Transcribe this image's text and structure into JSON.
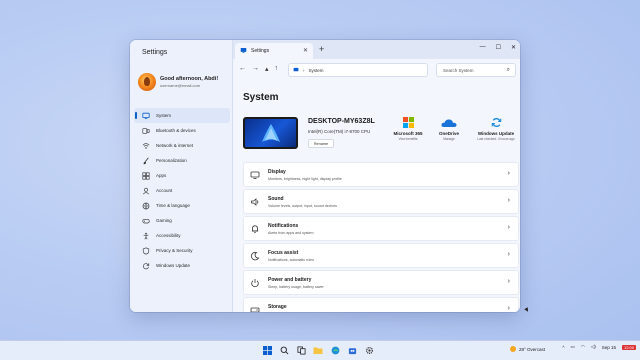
{
  "app": {
    "title": "Settings",
    "tab_label": "Settings"
  },
  "profile": {
    "greeting": "Good afternoon, Abdi!",
    "email": "username@email.com"
  },
  "sidebar": {
    "items": [
      {
        "label": "System",
        "icon": "monitor-icon",
        "active": true
      },
      {
        "label": "Bluetooth & devices",
        "icon": "bluetooth-icon"
      },
      {
        "label": "Network & internet",
        "icon": "wifi-icon"
      },
      {
        "label": "Personalization",
        "icon": "brush-icon"
      },
      {
        "label": "Apps",
        "icon": "apps-icon"
      },
      {
        "label": "Account",
        "icon": "person-icon"
      },
      {
        "label": "Time & language",
        "icon": "globe-icon"
      },
      {
        "label": "Gaming",
        "icon": "gamepad-icon"
      },
      {
        "label": "Accessibility",
        "icon": "accessibility-icon"
      },
      {
        "label": "Privacy & Security",
        "icon": "shield-icon"
      },
      {
        "label": "Windows Update",
        "icon": "update-icon"
      }
    ]
  },
  "addressbar": {
    "path": "System",
    "search_placeholder": "Search System"
  },
  "page": {
    "title": "System"
  },
  "device": {
    "name": "DESKTOP-MY63Z8L",
    "cpu": "Intel(R) Core(TM) i7-8700 CPU",
    "rename_label": "Rename"
  },
  "quick_links": [
    {
      "label": "Microsoft 365",
      "sub": "View benefits",
      "icon": "microsoft-365-icon"
    },
    {
      "label": "OneDrive",
      "sub": "Manage",
      "icon": "onedrive-icon"
    },
    {
      "label": "Windows Update",
      "sub": "Last checked: 4 hours ago",
      "icon": "windows-update-icon"
    }
  ],
  "settings": [
    {
      "title": "Display",
      "desc": "Monitors, brightness, night light, display profile",
      "icon": "display-icon"
    },
    {
      "title": "Sound",
      "desc": "Volume levels, output, input, sound devices",
      "icon": "speaker-icon"
    },
    {
      "title": "Notifications",
      "desc": "Alerts from apps and system",
      "icon": "bell-icon"
    },
    {
      "title": "Focus assist",
      "desc": "Notifications, automatic rules",
      "icon": "moon-icon"
    },
    {
      "title": "Power and battery",
      "desc": "Sleep, battery usage, battery saver",
      "icon": "power-icon"
    },
    {
      "title": "Storage",
      "desc": "",
      "icon": "storage-icon"
    }
  ],
  "taskbar": {
    "weather": "28° Overcast",
    "date": "Sep 15",
    "time": "12:00"
  },
  "colors": {
    "accent": "#0a5ecf"
  }
}
